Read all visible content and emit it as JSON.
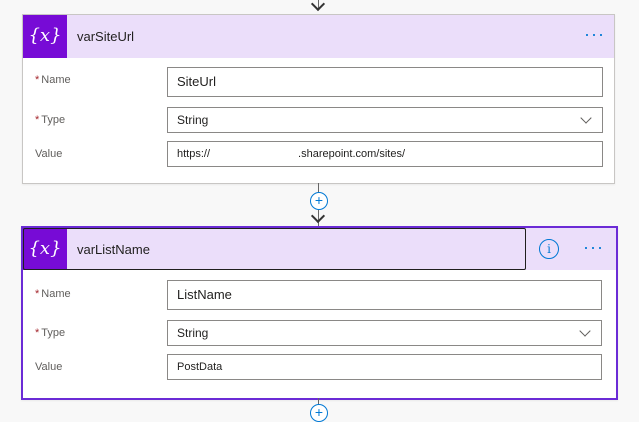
{
  "card1": {
    "title": "varSiteUrl",
    "icon_text": "{x}",
    "more": "···",
    "name_label": "Name",
    "name_value": "SiteUrl",
    "type_label": "Type",
    "type_value": "String",
    "value_label": "Value",
    "value_prefix": "https://",
    "value_middle": ".sharepoint.com/sites/"
  },
  "card2": {
    "title": "varListName",
    "icon_text": "{x}",
    "info": "i",
    "more": "···",
    "name_label": "Name",
    "name_value": "ListName",
    "type_label": "Type",
    "type_value": "String",
    "value_label": "Value",
    "value_value": "PostData"
  },
  "required_mark": "*",
  "add_step": "+",
  "colors": {
    "header_bg": "#ebdefa",
    "icon_bg": "#770bd6",
    "accent": "#0078d4",
    "selected_border": "#6b2bd6",
    "required": "#a4262c"
  },
  "icons": [
    "variable-icon",
    "more-options-icon",
    "info-icon",
    "add-step-icon",
    "arrow-down-icon",
    "chevron-down-icon"
  ]
}
